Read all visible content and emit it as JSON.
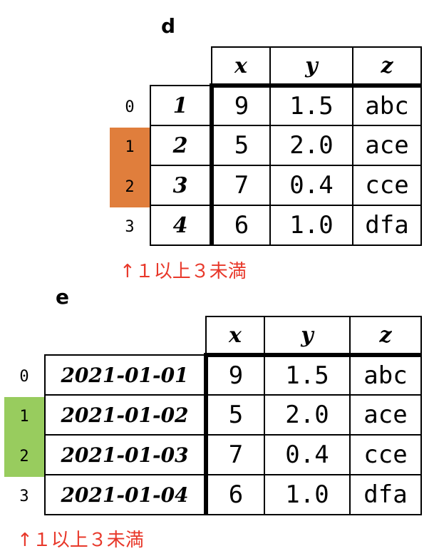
{
  "colors": {
    "highlight_d": "#e07e3c",
    "highlight_e": "#98cc5e",
    "note": "#e8382a"
  },
  "table_d": {
    "title": "d",
    "columns": [
      "x",
      "y",
      "z"
    ],
    "row_numbers": [
      "0",
      "1",
      "2",
      "3"
    ],
    "highlighted_rows": [
      1,
      2
    ],
    "index": [
      "1",
      "2",
      "3",
      "4"
    ],
    "rows": [
      [
        "9",
        "1.5",
        "abc"
      ],
      [
        "5",
        "2.0",
        "ace"
      ],
      [
        "7",
        "0.4",
        "cce"
      ],
      [
        "6",
        "1.0",
        "dfa"
      ]
    ],
    "note": "↑１以上３未満"
  },
  "table_e": {
    "title": "e",
    "columns": [
      "x",
      "y",
      "z"
    ],
    "row_numbers": [
      "0",
      "1",
      "2",
      "3"
    ],
    "highlighted_rows": [
      1,
      2
    ],
    "index": [
      "2021-01-01",
      "2021-01-02",
      "2021-01-03",
      "2021-01-04"
    ],
    "rows": [
      [
        "9",
        "1.5",
        "abc"
      ],
      [
        "5",
        "2.0",
        "ace"
      ],
      [
        "7",
        "0.4",
        "cce"
      ],
      [
        "6",
        "1.0",
        "dfa"
      ]
    ],
    "note": "↑１以上３未満"
  }
}
